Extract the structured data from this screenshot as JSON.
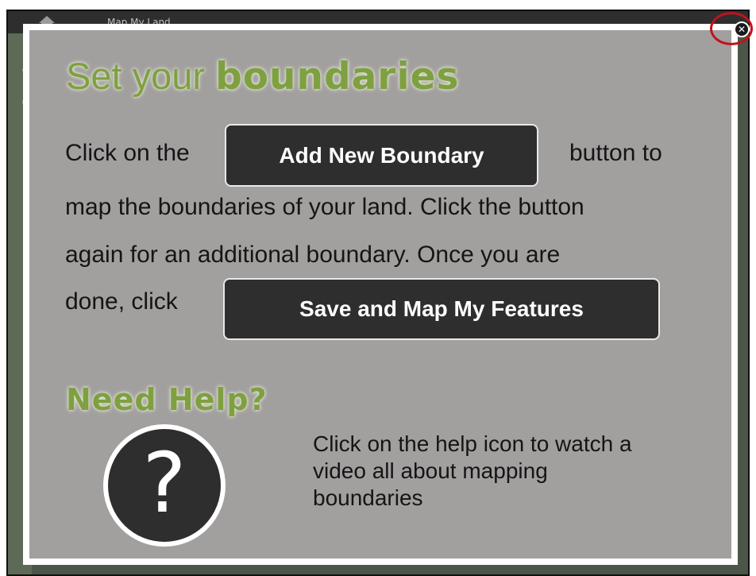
{
  "app": {
    "title": "Map My Land",
    "side_fragments": [
      "at",
      "te"
    ]
  },
  "modal": {
    "heading_regular": "Set your ",
    "heading_bold": "boundaries",
    "line1_before": "Click on the",
    "add_button_label": "Add New Boundary",
    "line1_after": "button to",
    "line2": "map the boundaries of your land. Click the button",
    "line3": "again for an additional boundary. Once you are",
    "line4_before": "done, click",
    "save_button_label": "Save and Map My Features",
    "help_heading": "Need Help?",
    "help_icon_glyph": "?",
    "help_text": "Click on the help icon to watch a video all about mapping boundaries",
    "close_glyph": "✕"
  },
  "colors": {
    "accent_green": "#7fa041",
    "panel_gray": "#a29f9f",
    "button_dark": "#2e2e2e",
    "highlight_red": "#c1121c"
  },
  "icons": {
    "home": "home-icon",
    "help": "help-icon",
    "close": "close-icon"
  }
}
